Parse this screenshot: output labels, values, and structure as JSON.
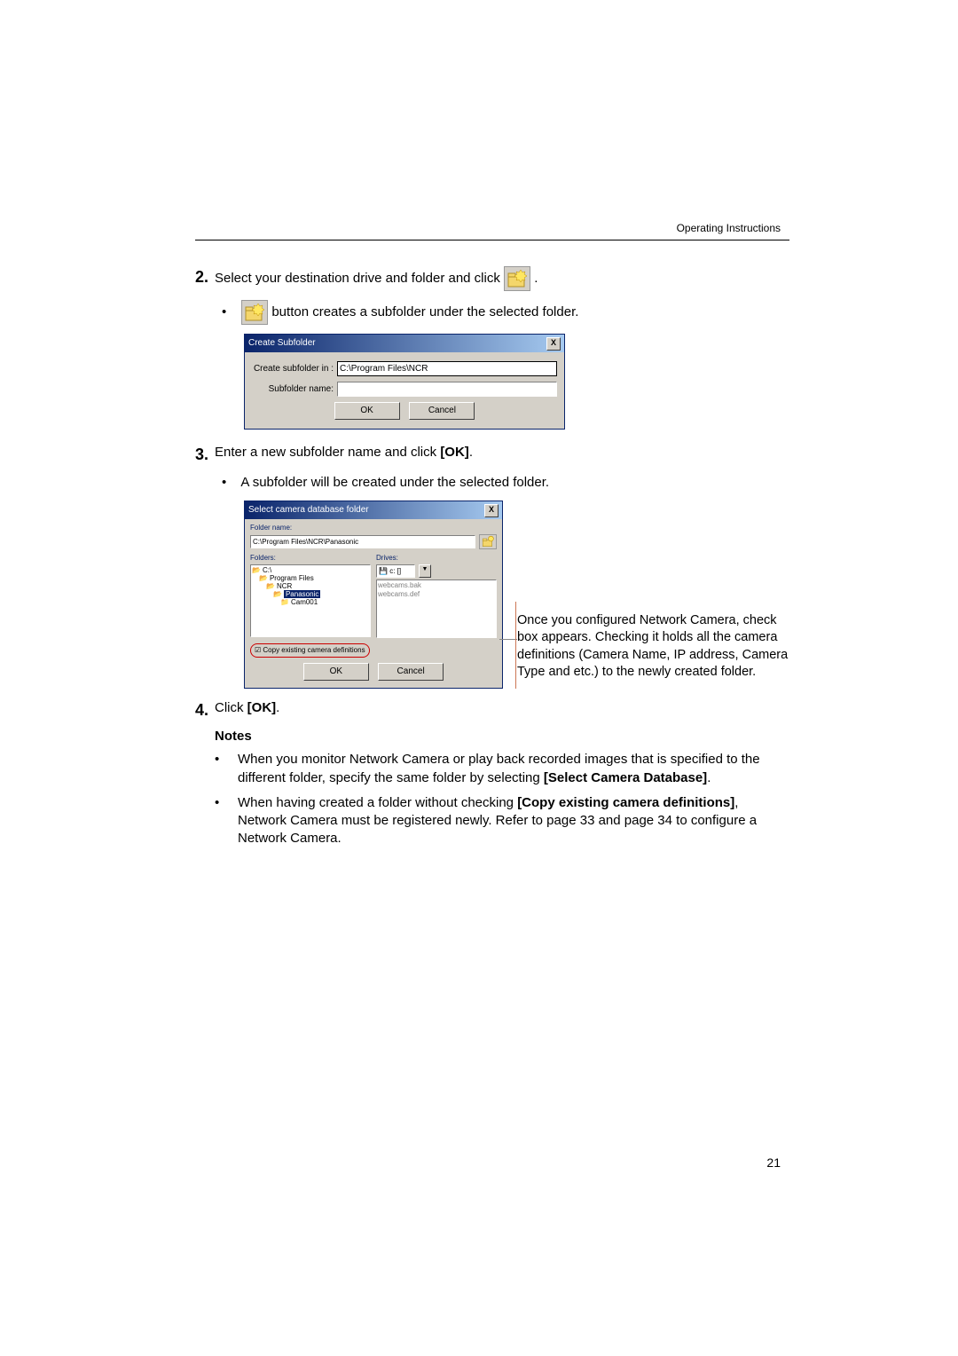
{
  "header": {
    "title": "Operating Instructions"
  },
  "step2": {
    "number": "2.",
    "text_prefix": "Select your destination drive and folder and click ",
    "text_suffix": " .",
    "sub_text": " button creates a subfolder under the selected folder."
  },
  "dialog_create_subfolder": {
    "title": "Create Subfolder",
    "close_x": "X",
    "row1_label": "Create subfolder in :",
    "row1_value": "C:\\Program Files\\NCR",
    "row2_label": "Subfolder name:",
    "row2_value": "",
    "ok": "OK",
    "cancel": "Cancel"
  },
  "step3": {
    "number": "3.",
    "text_a": "Enter a new subfolder name and click ",
    "text_bold": "[OK]",
    "text_b": ".",
    "sub_text": "A subfolder will be created under the selected folder."
  },
  "dialog_select": {
    "title": "Select camera database folder",
    "close_x": "X",
    "folder_name_label": "Folder name:",
    "folder_name_value": "C:\\Program Files\\NCR\\Panasonic",
    "folders_label": "Folders:",
    "drives_label": "Drives:",
    "drives_value": "c: []",
    "tree": {
      "root": "C:\\",
      "n1": "Program Files",
      "n2": "NCR",
      "n3": "Panasonic",
      "n4": "Cam001"
    },
    "right_list": {
      "a": "webcams.bak",
      "b": "webcams.def"
    },
    "checkbox_label": "Copy existing camera definitions",
    "ok": "OK",
    "cancel": "Cancel"
  },
  "annotation": {
    "text": "Once you configured Network Camera, check box appears. Checking it holds all the camera definitions (Camera Name, IP address, Camera Type and etc.) to the newly created folder."
  },
  "step4": {
    "number": "4.",
    "text_a": "Click ",
    "text_bold": "[OK]",
    "text_b": "."
  },
  "notes": {
    "heading": "Notes",
    "item1_a": "When you monitor Network Camera or play back recorded images that is specified to the different folder, specify the same folder by selecting ",
    "item1_bold": "[Select Camera Database]",
    "item1_b": ".",
    "item2_a": "When having created a folder without checking ",
    "item2_bold": "[Copy existing camera definitions]",
    "item2_b": ", Network Camera must be registered newly. Refer to page 33 and page 34 to configure a Network Camera."
  },
  "page_number": "21"
}
